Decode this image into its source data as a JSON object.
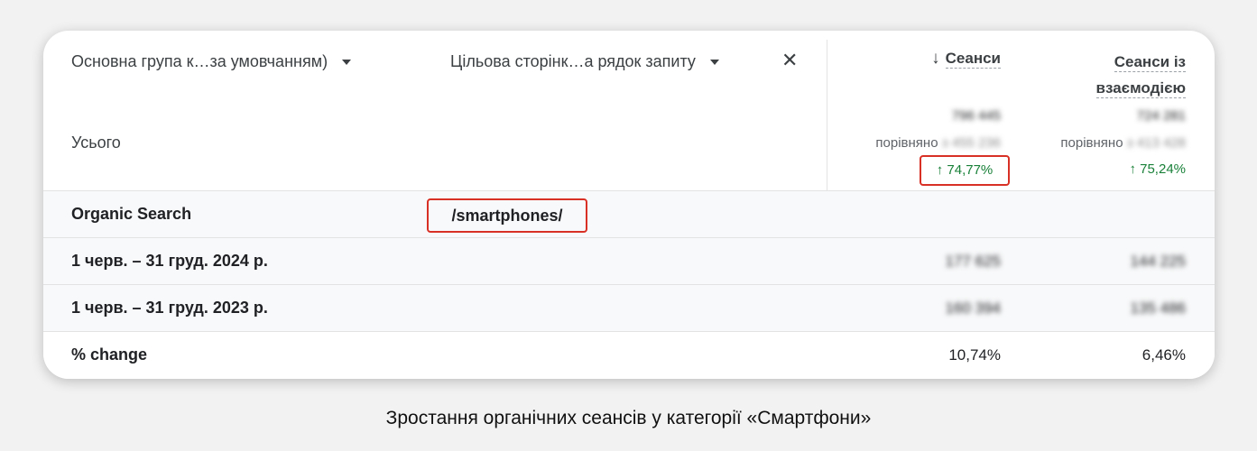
{
  "table": {
    "dimension_headers": [
      "Основна група к…за умовчанням)",
      "Цільова сторінк…а рядок запиту"
    ],
    "metric_headers": {
      "sessions": "Сеанси",
      "engaged_line1": "Сеанси із",
      "engaged_line2": "взаємодією"
    },
    "total_label": "Усього",
    "totals": {
      "sessions_value": "796 445",
      "engaged_value": "724 281",
      "compare_prefix": "порівняно",
      "sessions_compare": "з 455 236",
      "engaged_compare": "з 413 428",
      "sessions_change": "↑ 74,77%",
      "engaged_change": "↑ 75,24%"
    },
    "rows": [
      {
        "label": "Organic Search",
        "landing_page": "/smartphones/",
        "sessions": "",
        "engaged": ""
      },
      {
        "label": "1 черв. – 31 груд. 2024 р.",
        "landing_page": "",
        "sessions": "177 625",
        "engaged": "144 225"
      },
      {
        "label": "1 черв. – 31 груд. 2023 р.",
        "landing_page": "",
        "sessions": "160 394",
        "engaged": "135 486"
      },
      {
        "label": "% change",
        "landing_page": "",
        "sessions": "10,74%",
        "engaged": "6,46%"
      }
    ]
  },
  "caption": "Зростання органічних сеансів у категорії «Смартфони»",
  "colors": {
    "positive": "#188038",
    "highlight": "#d93025"
  },
  "icons": {
    "sort": "arrow-down-icon",
    "dropdown": "caret-down-icon",
    "remove": "close-icon"
  }
}
